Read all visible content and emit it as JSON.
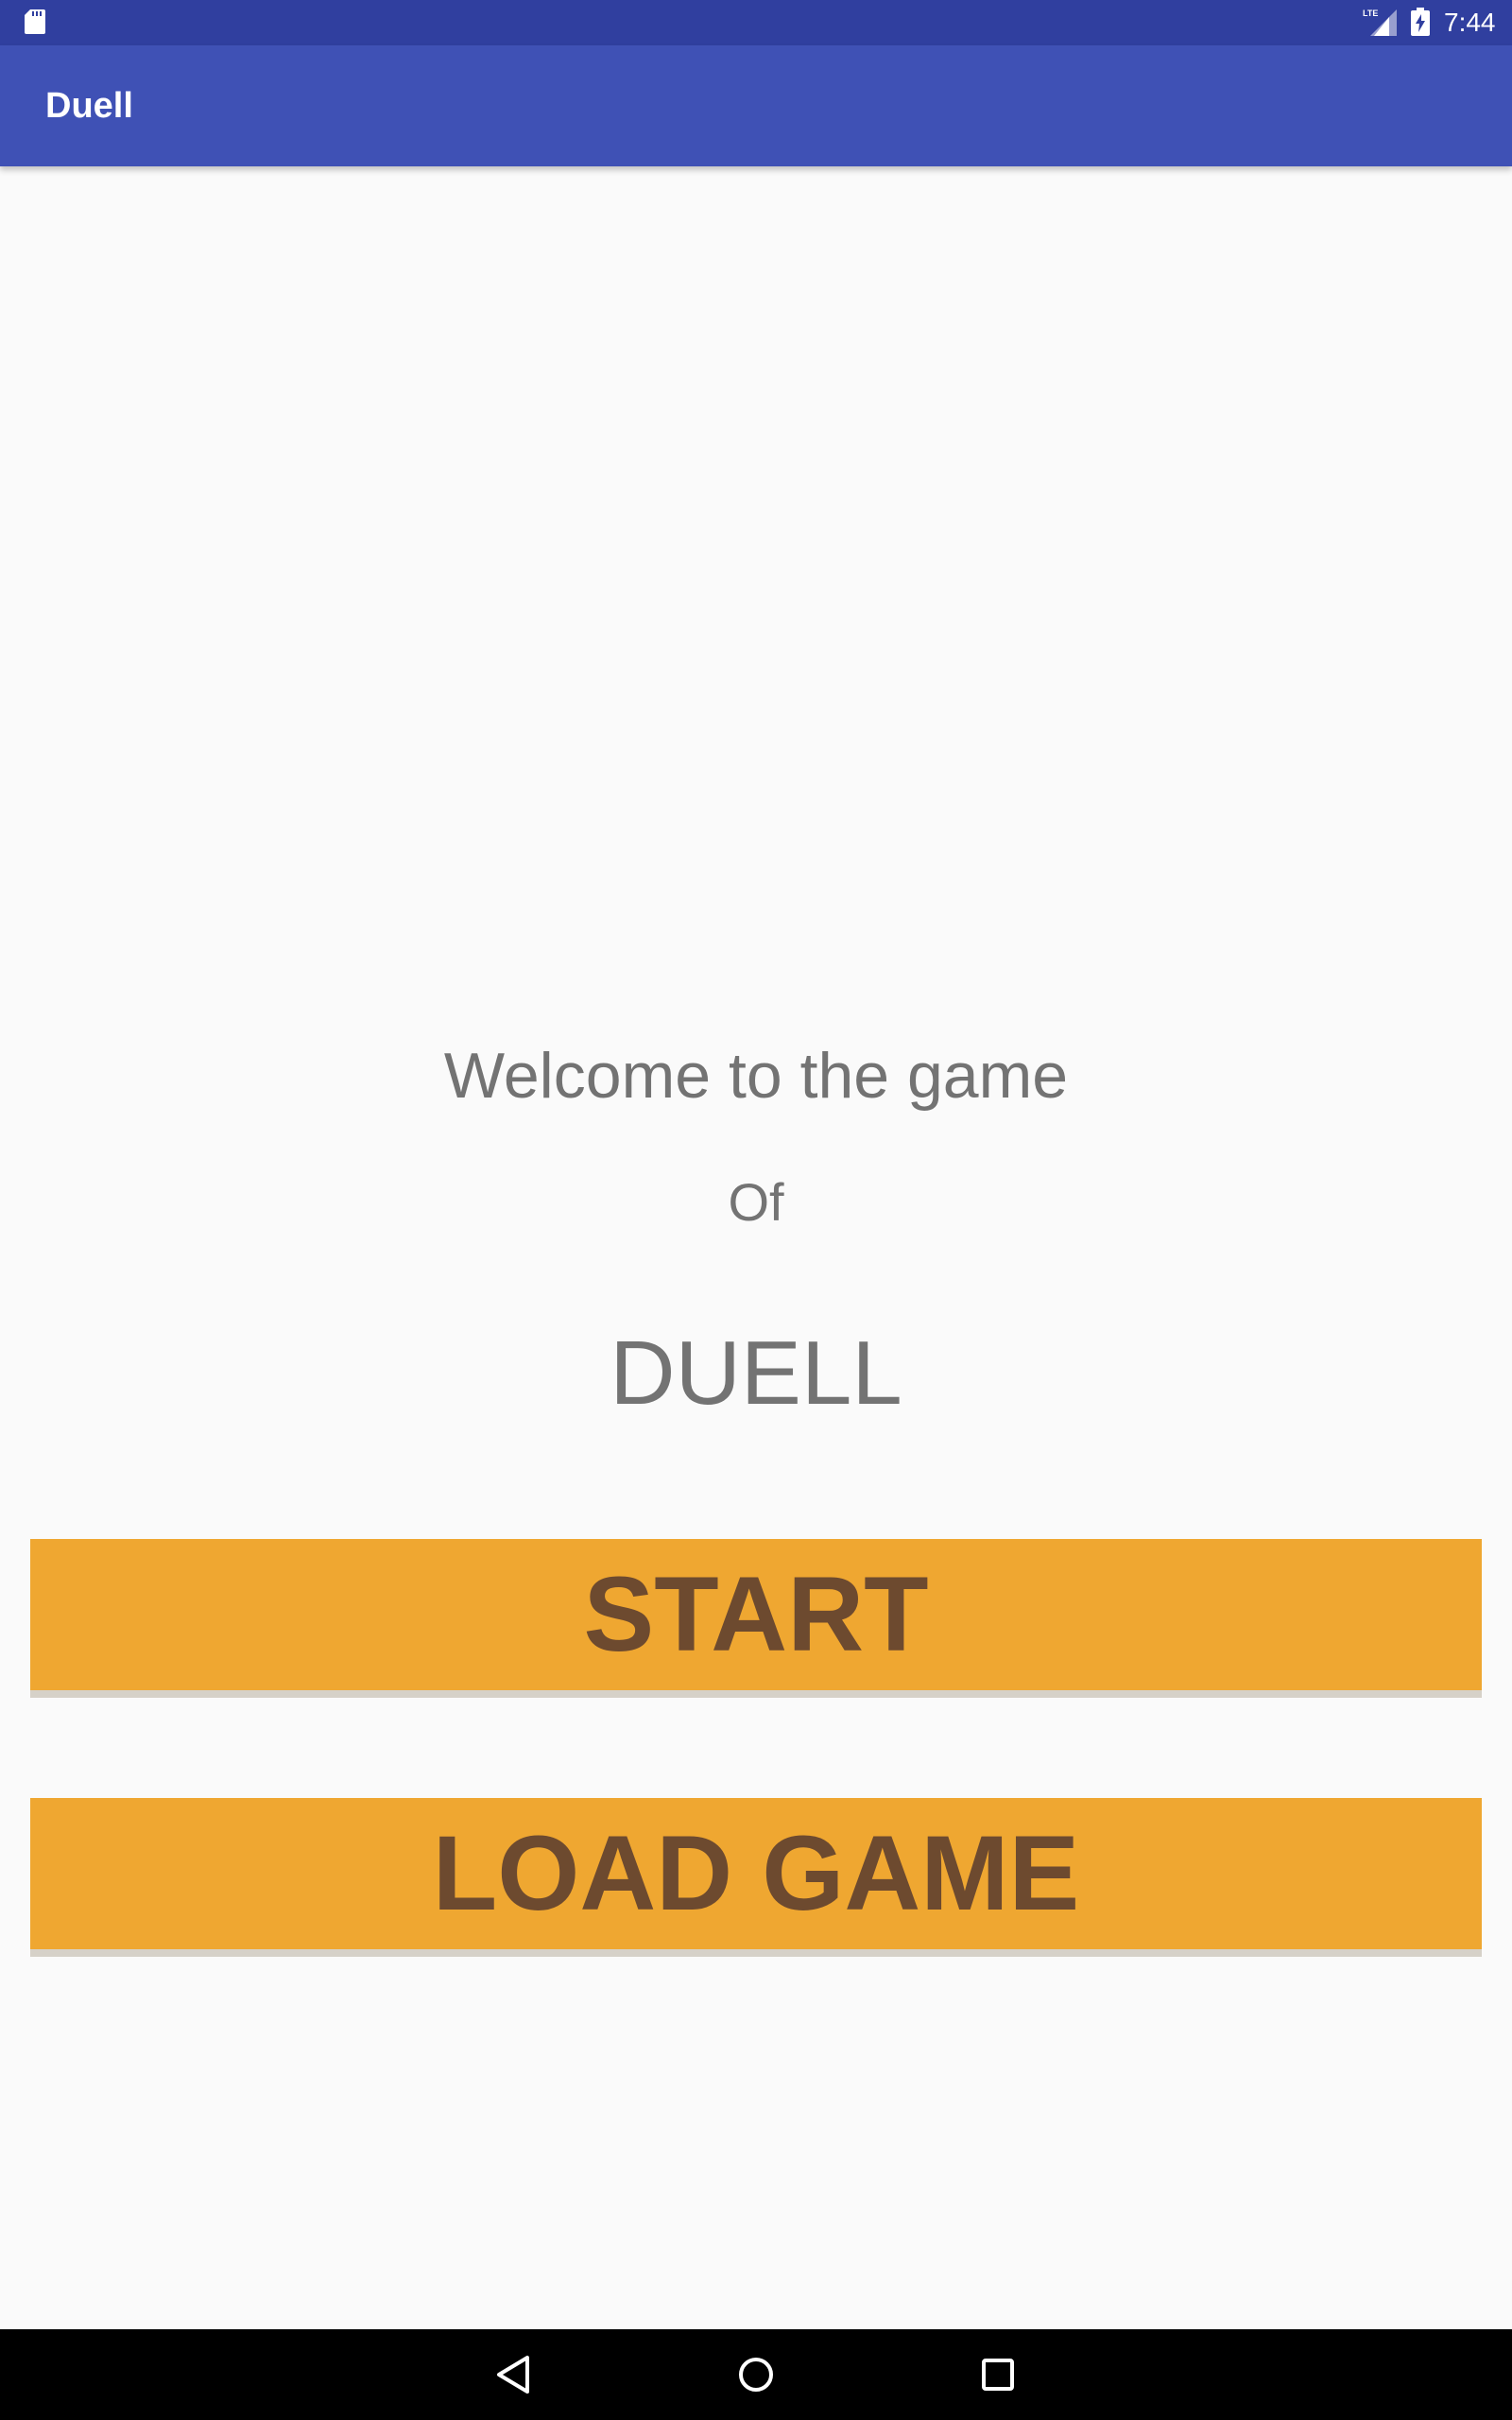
{
  "status_bar": {
    "time": "7:44",
    "network_label": "LTE",
    "icons": [
      "sd-card-icon",
      "lte-signal-icon",
      "battery-charging-icon"
    ]
  },
  "app_bar": {
    "title": "Duell",
    "color": "#3f51b5"
  },
  "main": {
    "welcome_text": "Welcome to the game",
    "of_text": "Of",
    "game_title": "DUELL",
    "start_button_label": "START",
    "load_button_label": "LOAD GAME",
    "button_color": "#efa731",
    "button_text_color": "#6d4a2f"
  },
  "nav_bar": {
    "icons": [
      "back-icon",
      "home-icon",
      "recents-icon"
    ]
  }
}
